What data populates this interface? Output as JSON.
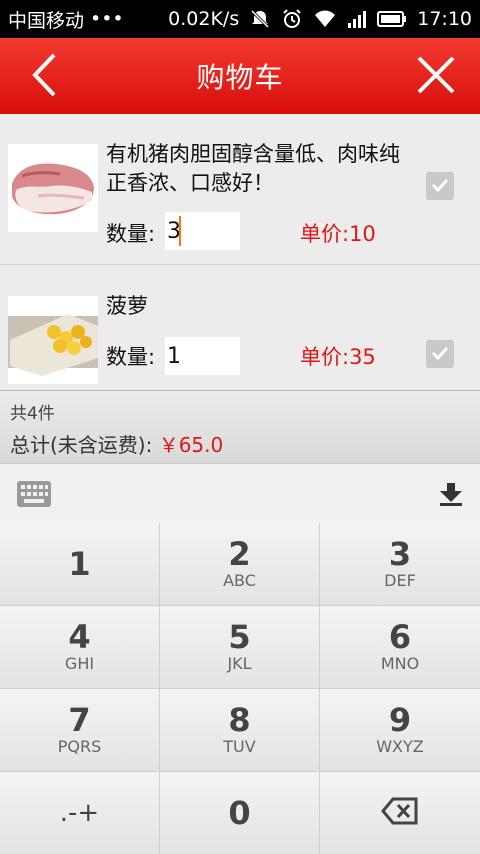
{
  "status_bar": {
    "carrier": "中国移动",
    "dots": "•••",
    "speed": "0.02K/s",
    "time": "17:10",
    "icons": [
      "no-notification-icon",
      "alarm-icon",
      "wifi-icon",
      "signal-icon",
      "battery-icon"
    ]
  },
  "header": {
    "title": "购物车",
    "back_icon": "back-chevron-icon",
    "close_icon": "close-icon"
  },
  "cart": {
    "items": [
      {
        "name": "有机猪肉胆固醇含量低、肉味纯正香浓、口感好！",
        "quantity_label": "数量:",
        "quantity": "3",
        "price_label": "单价:10",
        "checked": true
      },
      {
        "name": "菠萝",
        "quantity_label": "数量:",
        "quantity": "1",
        "price_label": "单价:35",
        "checked": true
      }
    ]
  },
  "summary": {
    "count": "共4件",
    "total_label": "总计(未含运费):",
    "total_value": "￥65.0"
  },
  "keyboard": {
    "keys": [
      {
        "digit": "1",
        "letters": ""
      },
      {
        "digit": "2",
        "letters": "ABC"
      },
      {
        "digit": "3",
        "letters": "DEF"
      },
      {
        "digit": "4",
        "letters": "GHI"
      },
      {
        "digit": "5",
        "letters": "JKL"
      },
      {
        "digit": "6",
        "letters": "MNO"
      },
      {
        "digit": "7",
        "letters": "PQRS"
      },
      {
        "digit": "8",
        "letters": "TUV"
      },
      {
        "digit": "9",
        "letters": "WXYZ"
      },
      {
        "digit": ".-+",
        "letters": ""
      },
      {
        "digit": "0",
        "letters": ""
      },
      {
        "digit": "",
        "letters": ""
      }
    ]
  },
  "colors": {
    "header_red": "#e01e18",
    "price_red": "#e01515",
    "caret_orange": "#f07a10"
  }
}
